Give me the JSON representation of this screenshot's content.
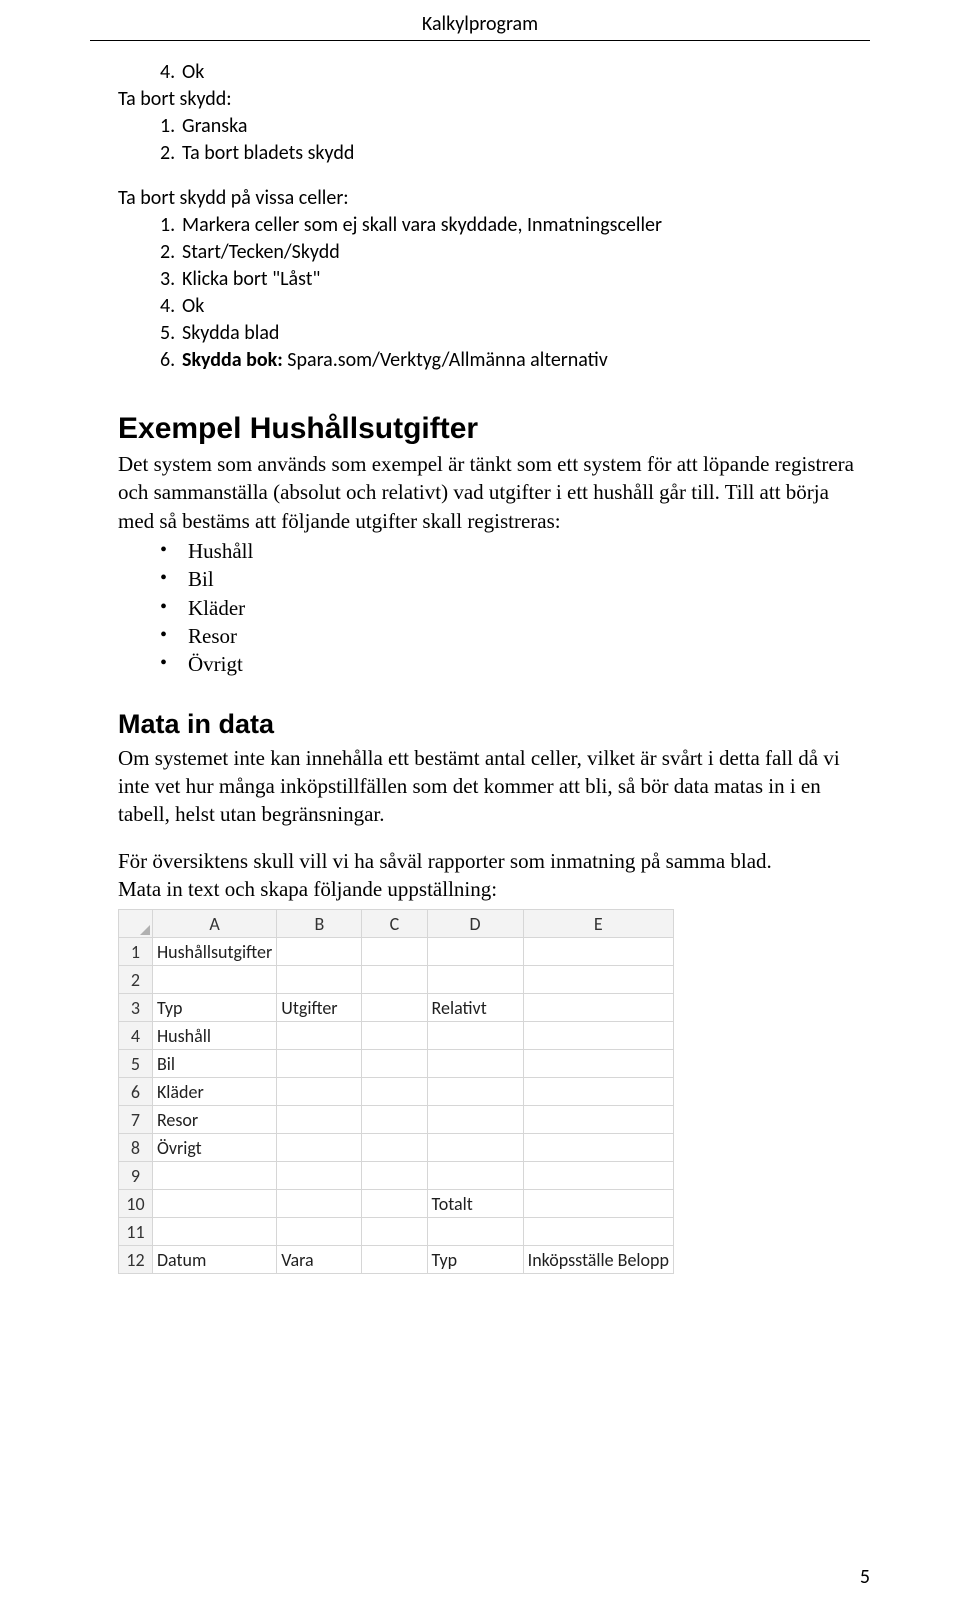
{
  "header": {
    "title": "Kalkylprogram"
  },
  "sectionA": {
    "item4_num": "4.",
    "item4_text": "Ok",
    "subtitle1": "Ta bort skydd:",
    "items1": [
      {
        "num": "1.",
        "text": "Granska"
      },
      {
        "num": "2.",
        "text": "Ta bort bladets skydd"
      }
    ],
    "subtitle2": "Ta bort skydd på vissa celler:",
    "items2": [
      {
        "num": "1.",
        "text": "Markera celler som ej skall vara skyddade, Inmatningsceller"
      },
      {
        "num": "2.",
        "text": "Start/Tecken/Skydd"
      },
      {
        "num": "3.",
        "text": "Klicka bort \"Låst\""
      },
      {
        "num": "4.",
        "text": "Ok"
      },
      {
        "num": "5.",
        "text": "Skydda blad"
      },
      {
        "num": "6.",
        "label_bold": "Skydda bok:",
        "text": " Spara.som/Verktyg/Allmänna alternativ"
      }
    ]
  },
  "exempel": {
    "heading": "Exempel Hushållsutgifter",
    "para": "Det system som används som exempel är tänkt som ett system för att löpande registrera och sammanställa (absolut och relativt) vad utgifter i ett hushåll går till. Till att börja med så bestäms att följande utgifter skall registreras:",
    "bullets": [
      "Hushåll",
      "Bil",
      "Kläder",
      "Resor",
      "Övrigt"
    ]
  },
  "mata": {
    "heading": "Mata in data",
    "para1": "Om systemet inte kan innehålla ett bestämt antal celler, vilket är svårt i detta fall då vi inte vet hur många inköpstillfällen som det kommer att bli, så bör data matas in i en tabell, helst utan begränsningar.",
    "para2": "För översiktens skull vill vi ha såväl rapporter som inmatning på samma blad.",
    "para3": "Mata in text och skapa följande uppställning:"
  },
  "sheet": {
    "cols": [
      "A",
      "B",
      "C",
      "D",
      "E"
    ],
    "rows": [
      {
        "n": "1",
        "cells": [
          "Hushållsutgifter",
          "",
          "",
          "",
          ""
        ]
      },
      {
        "n": "2",
        "cells": [
          "",
          "",
          "",
          "",
          ""
        ]
      },
      {
        "n": "3",
        "cells": [
          "Typ",
          "Utgifter",
          "",
          "Relativt",
          ""
        ]
      },
      {
        "n": "4",
        "cells": [
          "Hushåll",
          "",
          "",
          "",
          ""
        ]
      },
      {
        "n": "5",
        "cells": [
          "Bil",
          "",
          "",
          "",
          ""
        ]
      },
      {
        "n": "6",
        "cells": [
          "Kläder",
          "",
          "",
          "",
          ""
        ]
      },
      {
        "n": "7",
        "cells": [
          "Resor",
          "",
          "",
          "",
          ""
        ]
      },
      {
        "n": "8",
        "cells": [
          "Övrigt",
          "",
          "",
          "",
          ""
        ]
      },
      {
        "n": "9",
        "cells": [
          "",
          "",
          "",
          "",
          ""
        ]
      },
      {
        "n": "10",
        "cells": [
          "",
          "",
          "",
          "Totalt",
          ""
        ]
      },
      {
        "n": "11",
        "cells": [
          "",
          "",
          "",
          "",
          ""
        ]
      },
      {
        "n": "12",
        "cells": [
          "Datum",
          "Vara",
          "",
          "Typ",
          "Inköpsställe Belopp"
        ]
      }
    ]
  },
  "footer": {
    "pagenum": "5"
  }
}
